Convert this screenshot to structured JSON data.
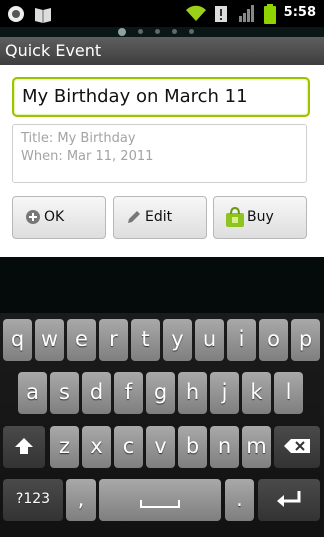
{
  "status_bar": {
    "time": "5:58",
    "icons": [
      "android-debug-icon",
      "book-icon",
      "wifi-icon",
      "alert-icon",
      "signal-icon",
      "battery-icon"
    ]
  },
  "dialog": {
    "title": "Quick Event",
    "input_value": "My Birthday on March 11",
    "preview_title": "Title: My Birthday",
    "preview_when": "When: Mar 11, 2011",
    "buttons": {
      "ok": "OK",
      "edit": "Edit",
      "buy": "Buy"
    }
  },
  "keyboard": {
    "row1": [
      "q",
      "w",
      "e",
      "r",
      "t",
      "y",
      "u",
      "i",
      "o",
      "p"
    ],
    "row2": [
      "a",
      "s",
      "d",
      "f",
      "g",
      "h",
      "j",
      "k",
      "l"
    ],
    "row3": [
      "z",
      "x",
      "c",
      "v",
      "b",
      "n",
      "m"
    ],
    "symbols_label": "?123",
    "comma": ",",
    "period": "."
  },
  "colors": {
    "input_focus": "#9dc300",
    "battery": "#8fd400"
  }
}
